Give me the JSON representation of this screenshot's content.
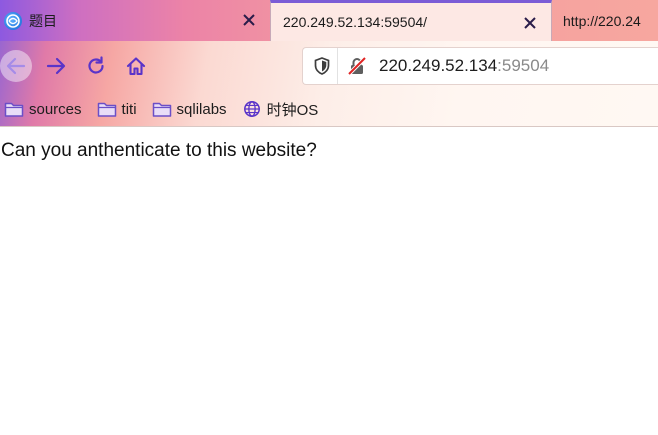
{
  "tabs": [
    {
      "title": "题目",
      "icon": "globe-app-icon",
      "active": false
    },
    {
      "title": "220.249.52.134:59504/",
      "active": true,
      "close": "×"
    },
    {
      "title": "http://220.24",
      "active": false
    }
  ],
  "toolbar": {
    "back_icon": "back-arrow-icon",
    "forward_icon": "forward-arrow-icon",
    "reload_icon": "reload-icon",
    "home_icon": "home-icon"
  },
  "urlbar": {
    "host": "220.249.52.134",
    "port": ":59504",
    "shield_icon": "tracking-shield-icon",
    "lock_icon": "insecure-lock-icon"
  },
  "bookmarks": [
    {
      "label": "sources",
      "icon": "folder-icon"
    },
    {
      "label": "titi",
      "icon": "folder-icon"
    },
    {
      "label": "sqlilabs",
      "icon": "folder-icon"
    },
    {
      "label": "时钟OS",
      "icon": "globe-icon"
    }
  ],
  "page": {
    "text": "Can you anthenticate to this website?"
  },
  "colors": {
    "accent": "#7b5cd6",
    "icon": "#5a34c9",
    "tab_active_bg": "#fde8e4"
  }
}
